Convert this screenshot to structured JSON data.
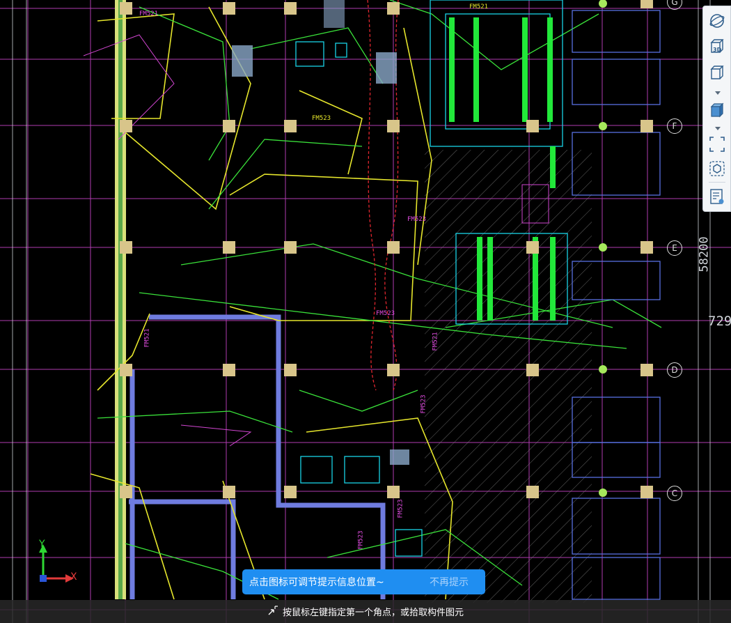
{
  "colors": {
    "background": "#000000",
    "grid_magenta": "#c040c0",
    "column_fill": "#e8e0a0",
    "wall_yellow": "#e6e62c",
    "wall_green": "#3ae23a",
    "cyan": "#19d3e6",
    "blue_wall": "#6f7cdf",
    "red_dash": "#e0262e",
    "tip_bg": "#1f8ef1"
  },
  "axis_labels": {
    "top_g": "G",
    "f": "F",
    "e": "E",
    "d": "D",
    "c": "C"
  },
  "dimensions": {
    "overall": "58200",
    "partial": "729"
  },
  "room_labels": [
    "FM521",
    "FM523",
    "FM521",
    "FM523",
    "FM523",
    "FM521",
    "FM523",
    "FM523",
    "FM523",
    "FM521"
  ],
  "axis_indicator": {
    "x_label": "X",
    "y_label": "Y"
  },
  "toolbar": {
    "icons": [
      "orbit-icon",
      "view-3d-icon",
      "box-outline-icon",
      "box-solid-icon",
      "fit-window-icon",
      "component-view-icon",
      "properties-icon"
    ],
    "label_3d": "3D"
  },
  "tip": {
    "message": "点击图标可调节提示信息位置~",
    "dismiss": "不再提示"
  },
  "status": {
    "prompt": "按鼠标左键指定第一个角点，或拾取构件图元"
  }
}
